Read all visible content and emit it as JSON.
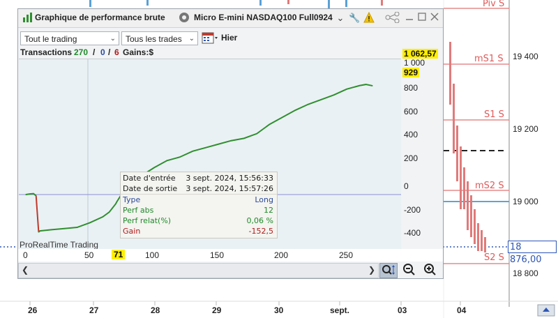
{
  "window": {
    "title": "Graphique de performance brute",
    "instrument": "Micro E-mini NASDAQ100 Full0924",
    "icons": [
      "bar-chart-icon",
      "settings-circle-icon",
      "chevron-down-icon",
      "wrench-icon",
      "warning-icon",
      "share-icon",
      "minimize-icon",
      "restore-icon",
      "close-icon"
    ]
  },
  "filters": {
    "trading_select": "Tout le trading",
    "trades_select": "Tous les trades",
    "date_label": "Hier"
  },
  "info": {
    "transactions_label": "Transactions",
    "transactions_total": "270",
    "sep1": "/",
    "transactions_zero": "0",
    "sep2": "/",
    "transactions_six": "6",
    "gains_label": "Gains:$"
  },
  "plot": {
    "watermark": "ProRealTime Trading",
    "y_badge_top": "1 062,57",
    "y_badge_current": "929",
    "y_ticks": [
      "1 000",
      "800",
      "600",
      "400",
      "200",
      "0",
      "-200",
      "-400"
    ],
    "x_ticks": [
      "0",
      "50",
      "100",
      "150",
      "200",
      "250"
    ],
    "x_badge": "71"
  },
  "tooltip": {
    "entry_label": "Date d'entrée",
    "entry_value": "3 sept. 2024, 15:56:33",
    "exit_label": "Date de sortie",
    "exit_value": "3 sept. 2024, 15:57:26",
    "type_label": "Type",
    "type_value": "Long",
    "perf_abs_label": "Perf abs",
    "perf_abs_value": "12",
    "perf_rel_label": "Perf relat(%)",
    "perf_rel_value": "0,06 %",
    "gain_label": "Gain",
    "gain_value": "-152,5"
  },
  "background_chart": {
    "levels": [
      "Piv S",
      "mS1 S",
      "S1 S",
      "mS2 S",
      "S2 S"
    ],
    "prices": [
      "19 400",
      "19 200",
      "19 000",
      "18 800"
    ],
    "current_price": "18 876,00",
    "dates": [
      "26",
      "27",
      "28",
      "29",
      "30",
      "sept.",
      "03",
      "04"
    ]
  },
  "chart_data": {
    "type": "line",
    "x": [
      0,
      3,
      6,
      8,
      10,
      11,
      20,
      30,
      40,
      50,
      60,
      65,
      70,
      71,
      75,
      80,
      90,
      100,
      110,
      120,
      130,
      140,
      150,
      160,
      170,
      180,
      190,
      200,
      210,
      220,
      230,
      240,
      250,
      260,
      265,
      270
    ],
    "values": [
      0,
      5,
      8,
      -10,
      -320,
      -310,
      -300,
      -290,
      -280,
      -240,
      -190,
      -150,
      -80,
      -60,
      10,
      70,
      160,
      230,
      290,
      320,
      370,
      400,
      430,
      460,
      480,
      520,
      600,
      660,
      720,
      770,
      810,
      850,
      900,
      930,
      940,
      929
    ],
    "ylim": [
      -500,
      1100
    ],
    "xlim": [
      0,
      280
    ],
    "colors": {
      "drop": "#c0392b",
      "line": "#2f8f2f"
    }
  }
}
